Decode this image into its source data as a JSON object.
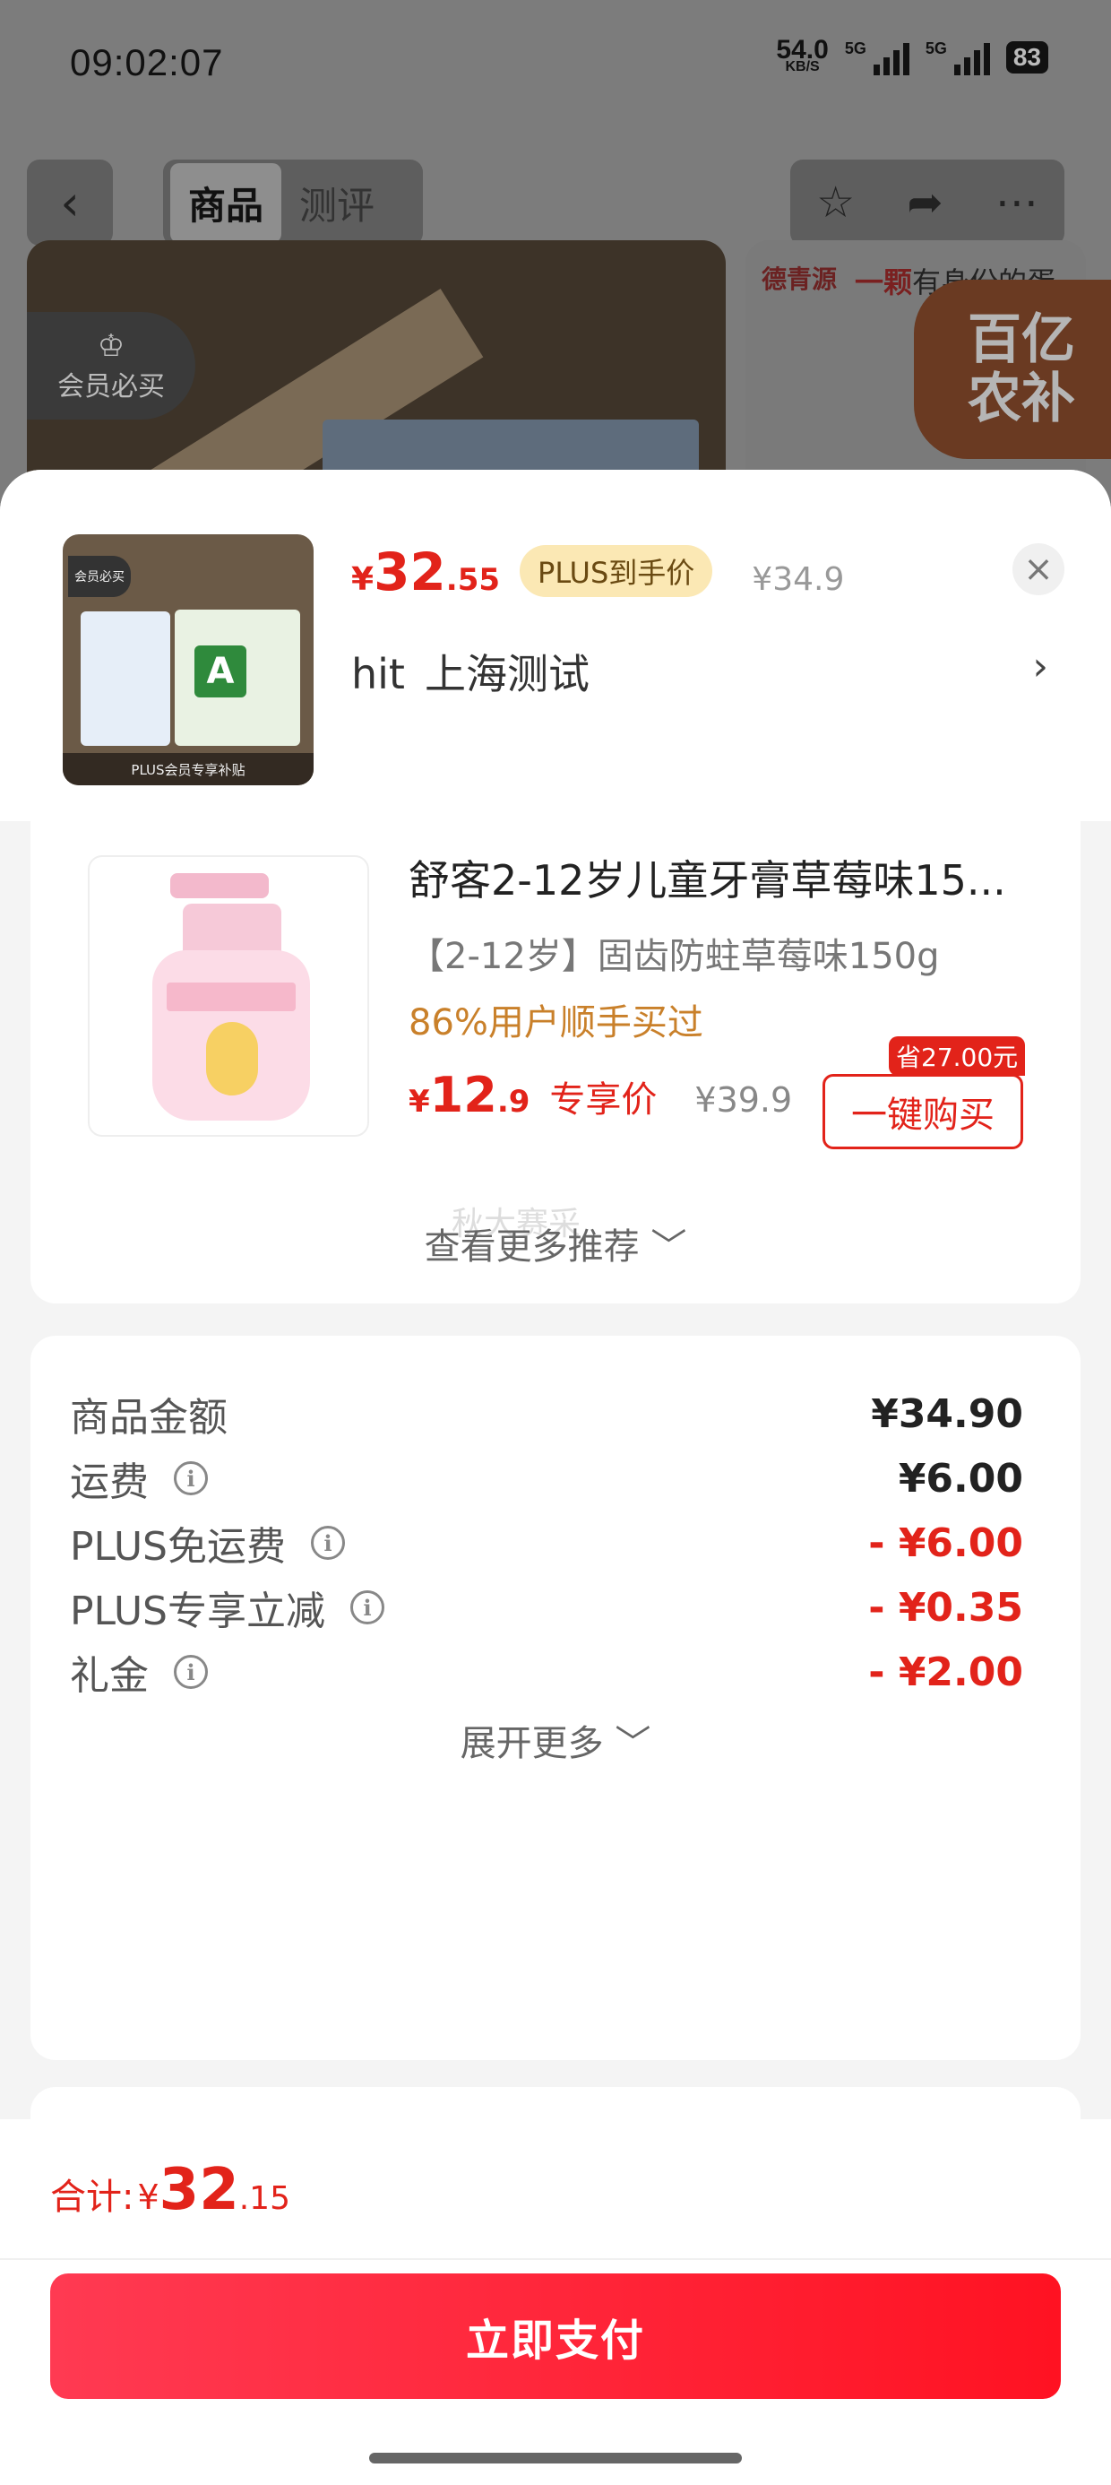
{
  "status_bar": {
    "time": "09:02:07",
    "net_speed": "54.0",
    "net_unit": "KB/S",
    "sim1": "5G",
    "sim2": "5G",
    "battery": "83"
  },
  "top_nav": {
    "back_icon": "chevron-left-icon",
    "tabs": [
      {
        "label": "商品",
        "active": true
      },
      {
        "label": "测评",
        "active": false
      }
    ],
    "actions": [
      "star-icon",
      "share-icon",
      "more-icon"
    ]
  },
  "background": {
    "member_badge": "会员必买",
    "brand": "德青源",
    "slogan_prefix": "一颗",
    "slogan_rest": "有身份的蛋",
    "promo_line1": "百亿",
    "promo_line2": "农补"
  },
  "product_header": {
    "price_symbol": "¥",
    "price_int": "32",
    "price_dec": ".55",
    "plus_label": "PLUS到手价",
    "original_price": "¥34.9",
    "address_user": "hit",
    "address_text": "上海测试",
    "thumb_tag": "会员必买",
    "thumb_footer": "PLUS会员专享补贴",
    "thumb_grade": "A"
  },
  "recommendation": {
    "title": "舒客2-12岁儿童牙膏草莓味15...",
    "spec": "【2-12岁】固齿防蛀草莓味150g",
    "bought": "86%用户顺手买过",
    "price_symbol": "¥",
    "price_int": "12",
    "price_dec": ".9",
    "exclusive_label": "专享价",
    "original_price": "¥39.9",
    "save_tag": "省27.00元",
    "buy_button": "一键购买",
    "ghost_text": "秋大赛采",
    "more_label": "查看更多推荐 ﹀"
  },
  "cost_breakdown": {
    "rows": [
      {
        "label": "商品金额",
        "value": "¥34.90",
        "info": false,
        "discount": false
      },
      {
        "label": "运费",
        "value": "¥6.00",
        "info": true,
        "discount": false
      },
      {
        "label": "PLUS免运费",
        "value": "- ¥6.00",
        "info": true,
        "discount": true
      },
      {
        "label": "PLUS专享立减",
        "value": "- ¥0.35",
        "info": true,
        "discount": true
      },
      {
        "label": "礼金",
        "value": "- ¥2.00",
        "info": true,
        "discount": true
      }
    ],
    "expand_label": "展开更多 ﹀"
  },
  "footer": {
    "total_label": "合计:",
    "total_symbol": "¥",
    "total_int": "32",
    "total_dec": ".15",
    "pay_button": "立即支付"
  },
  "colors": {
    "accent_red": "#e2231a",
    "plus_pill_bg": "#fbe8b4",
    "bought_orange": "#c9802a"
  }
}
